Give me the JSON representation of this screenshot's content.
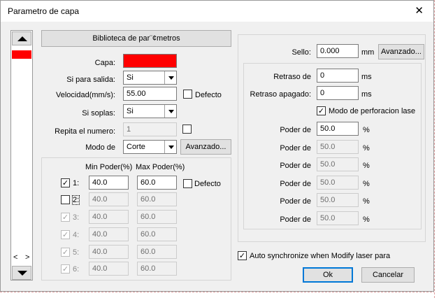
{
  "dialog": {
    "title": "Parametro de capa",
    "close_glyph": "✕"
  },
  "left": {
    "library_button": "Biblioteca de par¨¢metros",
    "layer_label": "Capa:",
    "layer_color": "#ff0000",
    "output_label": "Si para salida:",
    "output_value": "Si",
    "speed_label": "Velocidad(mm/s):",
    "speed_value": "55.00",
    "default_label": "Defecto",
    "blow_label": "Si soplas:",
    "blow_value": "Si",
    "repeat_label": "Repita el numero:",
    "repeat_value": "1",
    "mode_label": "Modo de",
    "mode_value": "Corte",
    "advanced_button": "Avanzado...",
    "min_header": "Min Poder(%)",
    "max_header": "Max Poder(%)",
    "power_default_label": "Defecto",
    "power_rows": [
      {
        "label": "1:",
        "checked": true,
        "min": "40.0",
        "max": "60.0"
      },
      {
        "label": "2:",
        "checked": false,
        "min": "40.0",
        "max": "60.0"
      },
      {
        "label": "3:",
        "checked": true,
        "min": "40.0",
        "max": "60.0"
      },
      {
        "label": "4:",
        "checked": true,
        "min": "40.0",
        "max": "60.0"
      },
      {
        "label": "5:",
        "checked": true,
        "min": "40.0",
        "max": "60.0"
      },
      {
        "label": "6:",
        "checked": true,
        "min": "40.0",
        "max": "60.0"
      }
    ]
  },
  "right": {
    "seal_label": "Sello:",
    "seal_value": "0.000",
    "seal_unit": "mm",
    "advanced_button": "Avanzado...",
    "delay_label": "Retraso de",
    "delay_value": "0",
    "delay_off_label": "Retraso apagado:",
    "delay_off_value": "0",
    "ms_unit": "ms",
    "perforation_label": "Modo de perforacion lase",
    "power_label": "Poder de",
    "percent_unit": "%",
    "power_values": [
      "50.0",
      "50.0",
      "50.0",
      "50.0",
      "50.0",
      "50.0"
    ],
    "auto_sync_label": "Auto synchronize when Modify laser para",
    "ok_button": "Ok",
    "cancel_button": "Cancelar"
  },
  "layer_list": {
    "scroll_left": "<",
    "scroll_right": ">"
  },
  "colors": {
    "accent": "#0078d7",
    "layer_red": "#ff0000"
  }
}
